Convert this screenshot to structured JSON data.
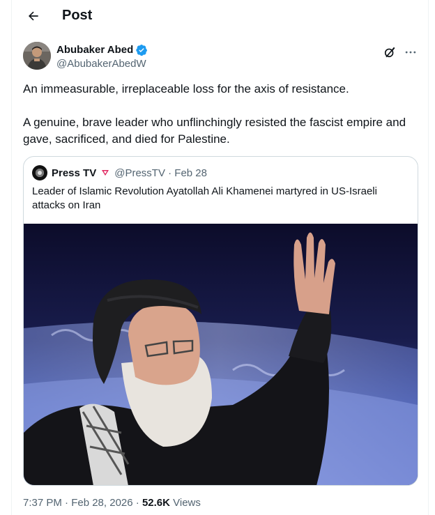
{
  "header": {
    "title": "Post"
  },
  "author": {
    "name": "Abubaker Abed",
    "handle": "@AbubakerAbedW",
    "verified": true
  },
  "tweet": {
    "paragraphs": [
      "An immeasurable, irreplaceable loss for the axis of resistance.",
      "A genuine, brave leader who unflinchingly resisted the fascist empire and gave, sacrificed, and died for Palestine."
    ]
  },
  "quote": {
    "name": "Press TV",
    "handle_date": "@PressTV · Feb 28",
    "text": "Leader of Islamic Revolution Ayatollah Ali Khamenei martyred in US-Israeli attacks on Iran"
  },
  "meta": {
    "time_date": "7:37 PM · Feb 28, 2026 · ",
    "views_count": "52.6K",
    "views_label": " Views"
  },
  "colors": {
    "verified_blue": "#1d9bf0",
    "secondary_text": "#536471",
    "border": "#cfd9de",
    "affiliate_badge": "#e0245e"
  },
  "icons": {
    "back": "arrow-left-icon",
    "verified": "verified-badge-icon",
    "grok": "grok-icon",
    "more": "more-horizontal-icon"
  }
}
